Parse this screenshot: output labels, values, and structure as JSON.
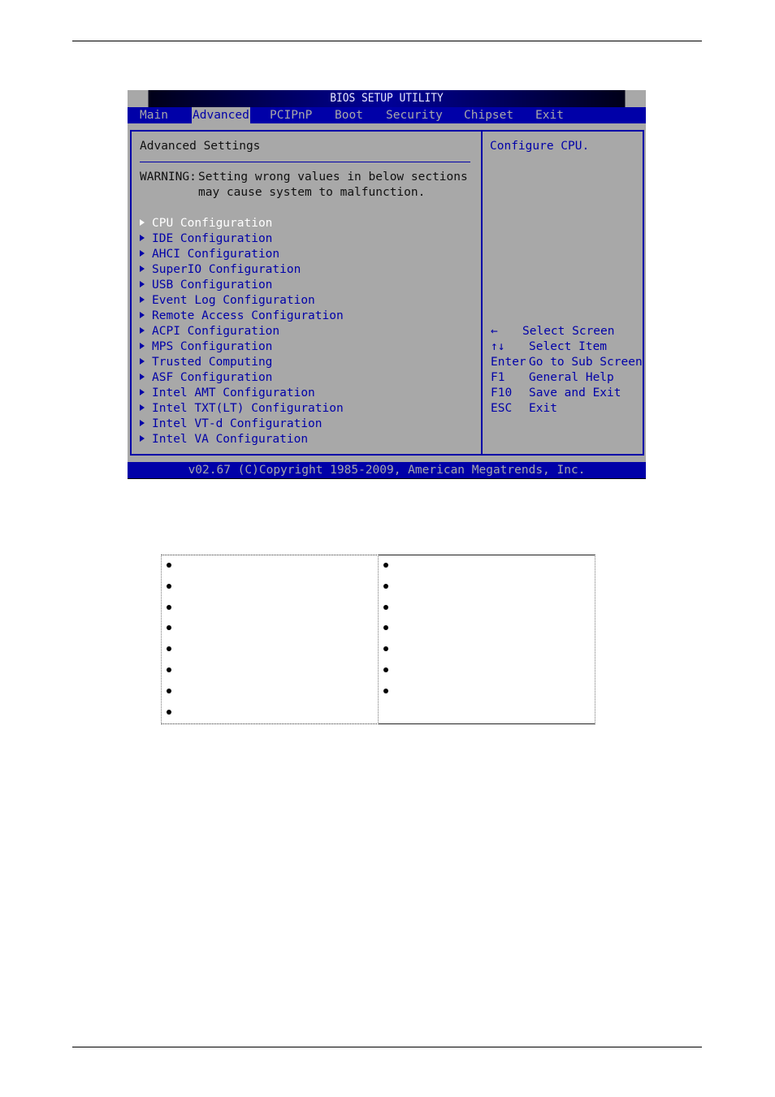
{
  "bios": {
    "title": "BIOS SETUP UTILITY",
    "tabs": [
      {
        "label": "Main",
        "active": false
      },
      {
        "label": "Advanced",
        "active": true
      },
      {
        "label": "PCIPnP",
        "active": false
      },
      {
        "label": "Boot",
        "active": false
      },
      {
        "label": "Security",
        "active": false
      },
      {
        "label": "Chipset",
        "active": false
      },
      {
        "label": "Exit",
        "active": false
      }
    ],
    "left_panel": {
      "heading": "Advanced Settings",
      "warning_label": "WARNING:",
      "warning_line1": "Setting wrong values in below sections",
      "warning_line2": "may cause system to malfunction.",
      "items": [
        {
          "label": "CPU Configuration",
          "selected": true
        },
        {
          "label": "IDE Configuration",
          "selected": false
        },
        {
          "label": "AHCI Configuration",
          "selected": false
        },
        {
          "label": "SuperIO Configuration",
          "selected": false
        },
        {
          "label": "USB Configuration",
          "selected": false
        },
        {
          "label": "Event Log Configuration",
          "selected": false
        },
        {
          "label": "Remote Access Configuration",
          "selected": false
        },
        {
          "label": "ACPI Configuration",
          "selected": false
        },
        {
          "label": "MPS Configuration",
          "selected": false
        },
        {
          "label": "Trusted Computing",
          "selected": false
        },
        {
          "label": "ASF Configuration",
          "selected": false
        },
        {
          "label": "Intel AMT Configuration",
          "selected": false
        },
        {
          "label": "Intel TXT(LT) Configuration",
          "selected": false
        },
        {
          "label": "Intel VT-d Configuration",
          "selected": false
        },
        {
          "label": "Intel VA Configuration",
          "selected": false
        }
      ]
    },
    "right_panel": {
      "help_text": "Configure CPU.",
      "keys": [
        {
          "key": "←",
          "desc": "Select Screen"
        },
        {
          "key": "↑↓",
          "desc": "Select Item"
        },
        {
          "key": "Enter",
          "desc": "Go to Sub Screen"
        },
        {
          "key": "F1",
          "desc": "General Help"
        },
        {
          "key": "F10",
          "desc": "Save and Exit"
        },
        {
          "key": "ESC",
          "desc": "Exit"
        }
      ]
    },
    "footer": "v02.67 (C)Copyright 1985-2009, American Megatrends, Inc.",
    "colors": {
      "bios_blue": "#0000a8",
      "bios_gray": "#a8a8a8",
      "selected_text": "#ffffff"
    }
  },
  "bullet_table": {
    "left_bullets": 8,
    "right_bullets": 7
  }
}
